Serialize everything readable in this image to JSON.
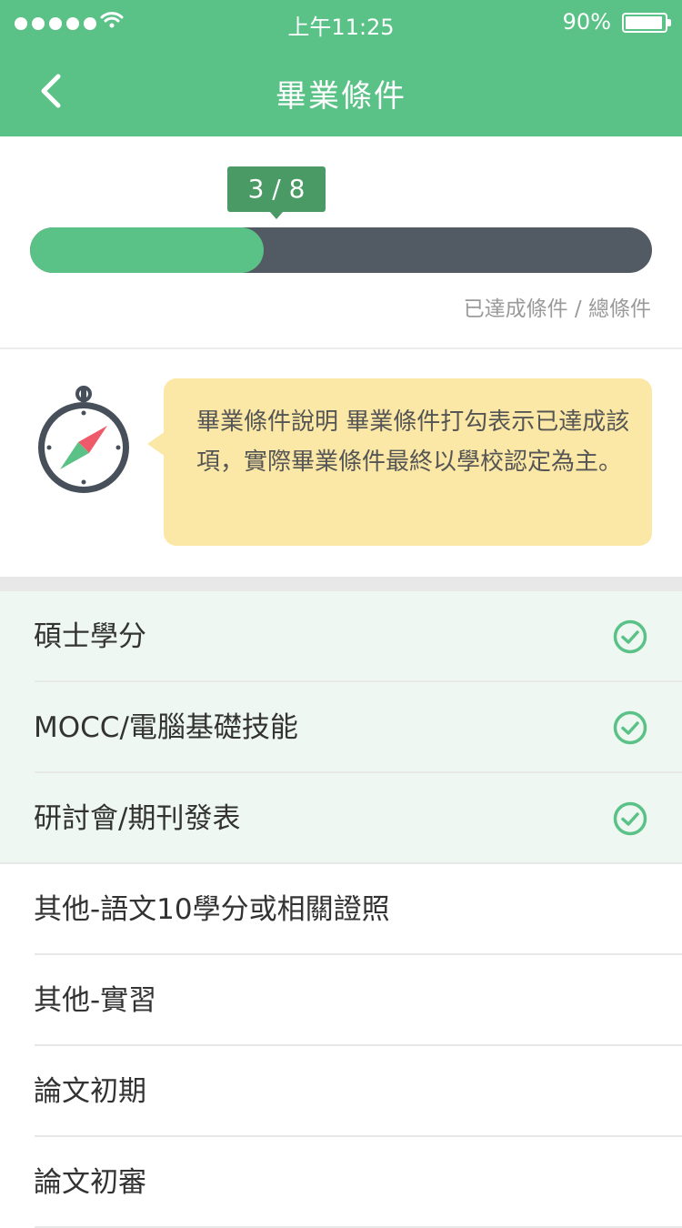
{
  "status_bar": {
    "time": "上午11:25",
    "battery": "90%"
  },
  "header": {
    "title": "畢業條件"
  },
  "progress": {
    "label": "3 / 8",
    "completed": 3,
    "total": 8,
    "caption": "已達成條件 / 總條件"
  },
  "info": {
    "text": "畢業條件說明 畢業條件打勾表示已達成該項，實際畢業條件最終以學校認定為主。"
  },
  "requirements": [
    {
      "label": "碩士學分",
      "done": true
    },
    {
      "label": "MOCC/電腦基礎技能",
      "done": true
    },
    {
      "label": "研討會/期刊發表",
      "done": true
    },
    {
      "label": "其他-語文10學分或相關證照",
      "done": false
    },
    {
      "label": "其他-實習",
      "done": false
    },
    {
      "label": "論文初期",
      "done": false
    },
    {
      "label": "論文初審",
      "done": false
    }
  ],
  "colors": {
    "accent": "#5bc287",
    "track": "#525a63",
    "note": "#fbe8a6"
  }
}
